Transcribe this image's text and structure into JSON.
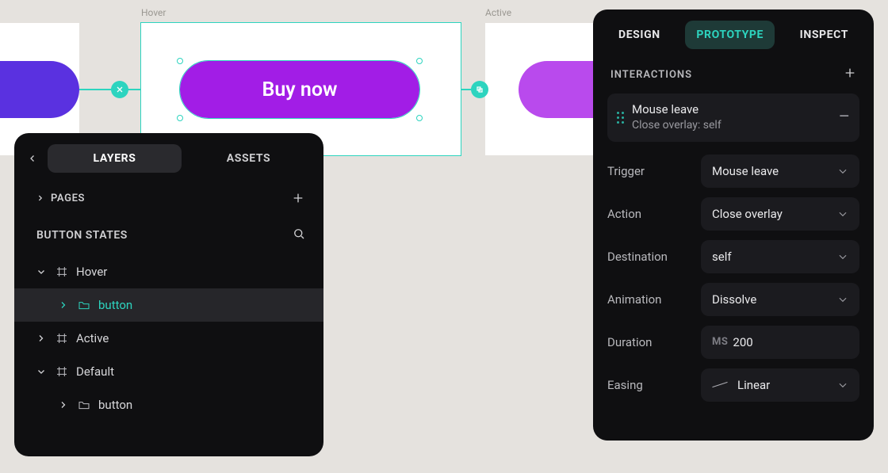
{
  "canvas": {
    "frames": {
      "default": {
        "label": "",
        "button_text": ""
      },
      "hover": {
        "label": "Hover",
        "button_text": "Buy now"
      },
      "active": {
        "label": "Active",
        "button_text": ""
      }
    }
  },
  "layers_panel": {
    "tabs": {
      "layers": "LAYERS",
      "assets": "ASSETS"
    },
    "pages_label": "PAGES",
    "file_title": "BUTTON STATES",
    "tree": {
      "hover": {
        "label": "Hover",
        "child": "button"
      },
      "active": {
        "label": "Active"
      },
      "default": {
        "label": "Default",
        "child": "button"
      }
    }
  },
  "proto_panel": {
    "tabs": {
      "design": "DESIGN",
      "prototype": "PROTOTYPE",
      "inspect": "INSPECT"
    },
    "section_title": "INTERACTIONS",
    "interaction": {
      "title": "Mouse leave",
      "subtitle": "Close overlay: self"
    },
    "rows": {
      "trigger": {
        "label": "Trigger",
        "value": "Mouse leave"
      },
      "action": {
        "label": "Action",
        "value": "Close overlay"
      },
      "destination": {
        "label": "Destination",
        "value": "self"
      },
      "animation": {
        "label": "Animation",
        "value": "Dissolve"
      },
      "duration": {
        "label": "Duration",
        "prefix": "MS",
        "value": "200"
      },
      "easing": {
        "label": "Easing",
        "value": "Linear"
      }
    }
  }
}
